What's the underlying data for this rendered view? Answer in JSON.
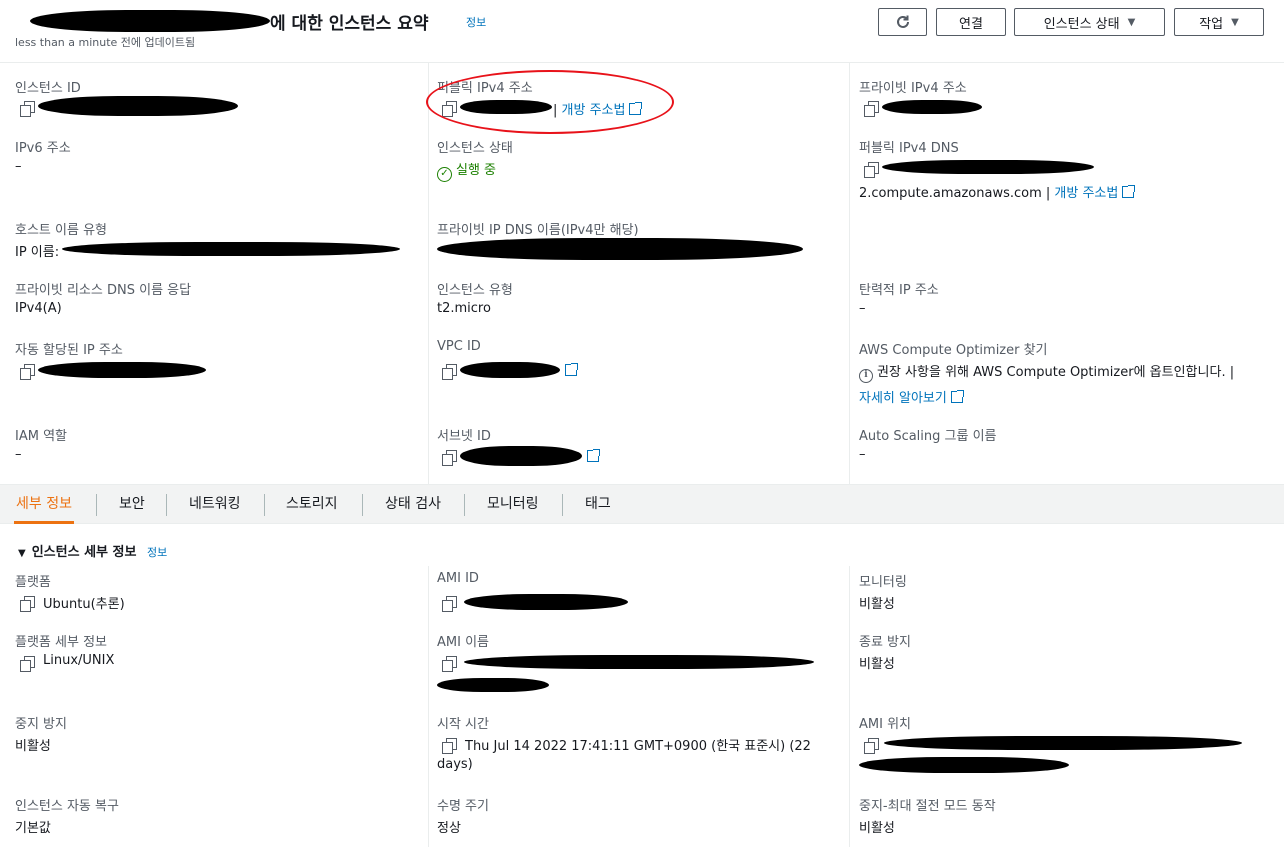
{
  "header": {
    "title": "에 대한 인스턴스 요약",
    "info": "정보",
    "updated": "less than a minute 전에 업데이트됨",
    "buttons": {
      "refresh": "",
      "connect": "연결",
      "instance_state": "인스턴스 상태",
      "actions": "작업"
    }
  },
  "summary": {
    "instance_id": {
      "label": "인스턴스 ID"
    },
    "public_ipv4": {
      "label": "퍼블릭 IPv4 주소",
      "link": "개방 주소법"
    },
    "private_ipv4": {
      "label": "프라이빗 IPv4 주소"
    },
    "ipv6": {
      "label": "IPv6 주소",
      "value": "–"
    },
    "state": {
      "label": "인스턴스 상태",
      "value": "실행 중"
    },
    "public_dns": {
      "label": "퍼블릭 IPv4 DNS",
      "value": "2.compute.amazonaws.com |",
      "link": "개방 주소법"
    },
    "hostname_type": {
      "label": "호스트 이름 유형",
      "value": "IP 이름:"
    },
    "private_ip_dns": {
      "label": "프라이빗 IP DNS 이름(IPv4만 해당)"
    },
    "private_resource_dns": {
      "label": "프라이빗 리소스 DNS 이름 응답",
      "value": "IPv4(A)"
    },
    "instance_type": {
      "label": "인스턴스 유형",
      "value": "t2.micro"
    },
    "elastic_ip": {
      "label": "탄력적 IP 주소",
      "value": "–"
    },
    "auto_ip": {
      "label": "자동 할당된 IP 주소"
    },
    "vpc_id": {
      "label": "VPC ID"
    },
    "optimizer": {
      "label": "AWS Compute Optimizer 찾기",
      "value": "권장 사항을 위해 AWS Compute Optimizer에 옵트인합니다. |",
      "link": "자세히 알아보기"
    },
    "iam_role": {
      "label": "IAM 역할",
      "value": "–"
    },
    "subnet_id": {
      "label": "서브넷 ID"
    },
    "auto_scaling": {
      "label": "Auto Scaling 그룹 이름",
      "value": "–"
    }
  },
  "tabs": [
    "세부 정보",
    "보안",
    "네트워킹",
    "스토리지",
    "상태 검사",
    "모니터링",
    "태그"
  ],
  "details": {
    "heading": "인스턴스 세부 정보",
    "info": "정보",
    "platform": {
      "label": "플랫폼",
      "value": "Ubuntu(추론)"
    },
    "ami_id": {
      "label": "AMI ID"
    },
    "monitoring": {
      "label": "모니터링",
      "value": "비활성"
    },
    "platform_details": {
      "label": "플랫폼 세부 정보",
      "value": "Linux/UNIX"
    },
    "ami_name": {
      "label": "AMI 이름"
    },
    "termination_protection": {
      "label": "종료 방지",
      "value": "비활성"
    },
    "stop_protection": {
      "label": "중지 방지",
      "value": "비활성"
    },
    "launch_time": {
      "label": "시작 시간",
      "value_line1": "Thu Jul 14 2022 17:41:11 GMT+0900 (한국 표준시) (22",
      "value_line2": "days)"
    },
    "ami_location": {
      "label": "AMI 위치"
    },
    "auto_recovery": {
      "label": "인스턴스 자동 복구",
      "value": "기본값"
    },
    "lifecycle": {
      "label": "수명 주기",
      "value": "정상"
    },
    "stop_hibernate": {
      "label": "중지-최대 절전 모드 동작",
      "value": "비활성"
    }
  }
}
